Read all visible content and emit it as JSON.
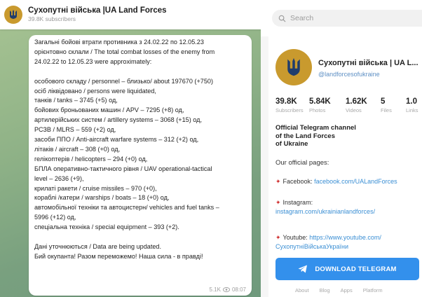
{
  "channel": {
    "title": "Сухопутні війська |UA Land Forces",
    "subscribers": "39.8K subscribers"
  },
  "search": {
    "placeholder": "Search"
  },
  "message": {
    "lines": [
      "Загальні бойові втрати противника з 24.02.22 по 12.05.23",
      "орієнтовно склали / The total combat losses of the enemy from",
      "24.02.22 to 12.05.23 were approximately:",
      "",
      "особового складу / personnel – близько/ about 197670 (+750)",
      "осіб ліквідовано / persons were liquidated,",
      "танків / tanks – 3745 (+5) од,",
      "бойових броньованих машин / APV – 7295 (+8) од,",
      "артилерійських систем / artillery systems – 3068 (+15) од,",
      "РСЗВ / MLRS – 559 (+2) од,",
      "засоби ППО / Anti-aircraft warfare systems – 312 (+2) од,",
      "літаків / aircraft – 308 (+0) од,",
      "гелікоптерів / helicopters – 294 (+0) од,",
      "БПЛА оперативно-тактичного рівня / UAV operational-tactical",
      "level – 2636 (+9),",
      "крилаті ракети / cruise missiles – 970 (+0),",
      "кораблі /катери / warships / boats – 18 (+0) од,",
      "автомобільної техніки та автоцистерн/ vehicles and fuel tanks –",
      "5996 (+12) од,",
      "спеціальна техніка / special equipment – 393 (+2).",
      "",
      "Дані уточнюються / Data are being updated.",
      "Бий окупанта! Разом переможемо! Наша сила - в правді!"
    ],
    "views": "5.1K",
    "time": "08:07"
  },
  "profile": {
    "name": "Сухопутні війська | UA L...",
    "handle": "@landforcesofukraine",
    "stats": [
      {
        "value": "39.8K",
        "label": "Subscribers"
      },
      {
        "value": "5.84K",
        "label": "Photos"
      },
      {
        "value": "1.62K",
        "label": "Videos"
      },
      {
        "value": "5",
        "label": "Files"
      },
      {
        "value": "1.0",
        "label": "Links"
      }
    ],
    "description": [
      "Official Telegram channel",
      "of the Land Forces",
      "of Ukraine"
    ],
    "pages_label": "Our official pages:",
    "facebook_label": "Facebook:",
    "facebook_url": "facebook.com/UALandForces",
    "instagram_label": "Instagram:",
    "instagram_url": "instagram.com/ukrainianlandforces/",
    "youtube_label": "Youtube:",
    "youtube_url": "https://www.youtube.com/",
    "youtube_url2": "СухопутніВійськаУкраїни",
    "download_label": "DOWNLOAD TELEGRAM",
    "footer": [
      "About",
      "Blog",
      "Apps",
      "Platform"
    ]
  },
  "colors": {
    "accent": "#3390ec",
    "avatar": "#c99a2e",
    "link": "#3b8fd4"
  },
  "icons": {
    "channel_avatar": "trident-icon",
    "search": "search-icon",
    "views": "eye-icon",
    "pin": "pushpin-icon",
    "download": "telegram-plane-icon"
  }
}
